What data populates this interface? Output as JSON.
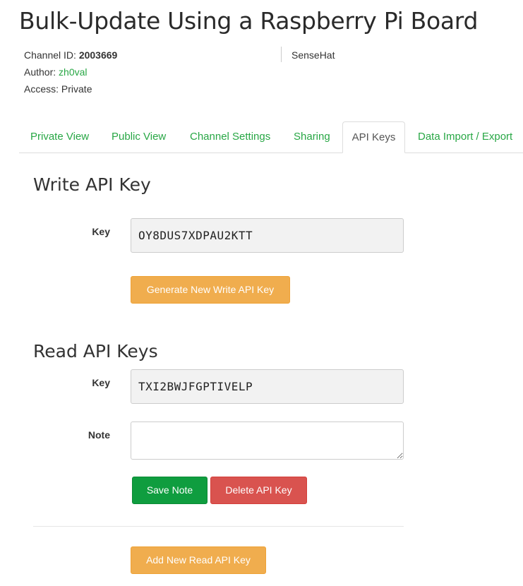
{
  "header": {
    "title": "Bulk-Update Using a Raspberry Pi Board",
    "channel_id_label": "Channel ID:",
    "channel_id": "2003669",
    "author_label": "Author:",
    "author": "zh0val",
    "access_label": "Access:",
    "access": "Private",
    "tag": "SenseHat"
  },
  "tabs": [
    {
      "label": "Private View"
    },
    {
      "label": "Public View"
    },
    {
      "label": "Channel Settings"
    },
    {
      "label": "Sharing"
    },
    {
      "label": "API Keys",
      "active": true
    },
    {
      "label": "Data Import / Export"
    }
  ],
  "write_section": {
    "title": "Write API Key",
    "key_label": "Key",
    "key_value": "OY8DUS7XDPAU2KTT",
    "generate_button": "Generate New Write API Key"
  },
  "read_section": {
    "title": "Read API Keys",
    "key_label": "Key",
    "key_value": "TXI2BWJFGPTIVELP",
    "note_label": "Note",
    "note_value": "",
    "save_button": "Save Note",
    "delete_button": "Delete API Key",
    "add_button": "Add New Read API Key"
  },
  "colors": {
    "link_green": "#28a745",
    "warning": "#f0ad4e",
    "success": "#0f9d3f",
    "danger": "#d9534f"
  }
}
